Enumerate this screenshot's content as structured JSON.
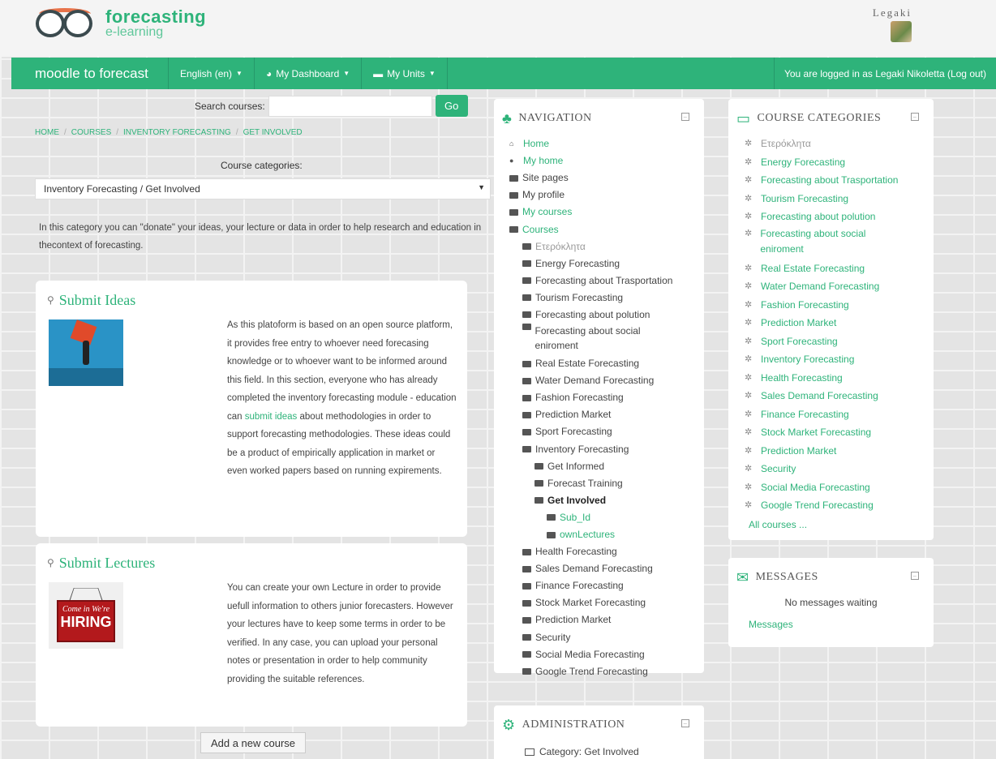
{
  "header": {
    "logo_main": "forecasting",
    "logo_sub": "e-learning",
    "user_name": "Legaki"
  },
  "navbar": {
    "brand": "moodle to forecast",
    "language": "English (en)",
    "dashboard": "My Dashboard",
    "units": "My Units",
    "login_text": "You are logged in as Legaki Nikoletta (Log out)"
  },
  "search": {
    "label": "Search courses:",
    "value": "",
    "button": "Go"
  },
  "breadcrumb": [
    "HOME",
    "COURSES",
    "INVENTORY FORECASTING",
    "GET INVOLVED"
  ],
  "category_select": {
    "label": "Course categories:",
    "value": "Inventory Forecasting / Get Involved"
  },
  "category_description": "In this category you can \"donate\" your ideas, your lecture or data in order to help research and education in thecontext of forecasting.",
  "cards": {
    "ideas": {
      "title": "Submit Ideas",
      "text_before": "As this platoform is based on an open source platform, it provides free entry to whoever need forecasing knowledge or to whoever want to be informed around this field. In this section, everyone who has already completed the inventory forecasting module - education can ",
      "link": "submit ideas",
      "text_after": " about methodologies in order to support forecasting methodologies. These ideas could be a product of empirically application in market or even worked papers based on running expirements."
    },
    "lectures": {
      "title": "Submit Lectures",
      "text": "You can create your own Lecture in order to provide uefull information to others junior forecasters. However your lectures have to keep some terms in order to be verified. In any case, you can upload your personal notes or presentation in order to help community providing the suitable references.",
      "image_text_a": "Come in We're",
      "image_text_b": "HIRING"
    }
  },
  "add_course": "Add a new course",
  "navigation": {
    "title": "NAVIGATION",
    "items": [
      {
        "label": "Home",
        "level": 0,
        "link": true,
        "icon": "home-icon"
      },
      {
        "label": "My home",
        "level": 0,
        "link": true,
        "icon": "dot-icon"
      },
      {
        "label": "Site pages",
        "level": 0,
        "link": false,
        "icon": "folder-icon"
      },
      {
        "label": "My profile",
        "level": 0,
        "link": false,
        "icon": "folder-icon"
      },
      {
        "label": "My courses",
        "level": 0,
        "link": true,
        "icon": "folder-icon"
      },
      {
        "label": "Courses",
        "level": 0,
        "link": true,
        "icon": "folder-icon"
      },
      {
        "label": "Ετερόκλητα",
        "level": 1,
        "link": false,
        "icon": "folder-icon",
        "muted": true
      },
      {
        "label": "Energy Forecasting",
        "level": 1,
        "link": false,
        "icon": "folder-icon"
      },
      {
        "label": "Forecasting about Trasportation",
        "level": 1,
        "link": false,
        "icon": "folder-icon"
      },
      {
        "label": "Tourism Forecasting",
        "level": 1,
        "link": false,
        "icon": "folder-icon"
      },
      {
        "label": "Forecasting about polution",
        "level": 1,
        "link": false,
        "icon": "folder-icon"
      },
      {
        "label": "Forecasting about social eniroment",
        "level": 1,
        "link": false,
        "icon": "folder-icon",
        "wrap": true
      },
      {
        "label": "Real Estate Forecasting",
        "level": 1,
        "link": false,
        "icon": "folder-icon"
      },
      {
        "label": "Water Demand Forecasting",
        "level": 1,
        "link": false,
        "icon": "folder-icon"
      },
      {
        "label": "Fashion Forecasting",
        "level": 1,
        "link": false,
        "icon": "folder-icon"
      },
      {
        "label": "Prediction Market",
        "level": 1,
        "link": false,
        "icon": "folder-icon"
      },
      {
        "label": "Sport Forecasting",
        "level": 1,
        "link": false,
        "icon": "folder-icon"
      },
      {
        "label": "Inventory Forecasting",
        "level": 1,
        "link": false,
        "icon": "folder-icon"
      },
      {
        "label": "Get Informed",
        "level": 2,
        "link": false,
        "icon": "folder-icon"
      },
      {
        "label": "Forecast Training",
        "level": 2,
        "link": false,
        "icon": "folder-icon"
      },
      {
        "label": "Get Involved",
        "level": 2,
        "link": false,
        "icon": "folder-icon",
        "active": true
      },
      {
        "label": "Sub_Id",
        "level": 3,
        "link": true,
        "icon": "folder-icon"
      },
      {
        "label": "ownLectures",
        "level": 3,
        "link": true,
        "icon": "folder-icon"
      },
      {
        "label": "Health Forecasting",
        "level": 1,
        "link": false,
        "icon": "folder-icon"
      },
      {
        "label": "Sales Demand Forecasting",
        "level": 1,
        "link": false,
        "icon": "folder-icon"
      },
      {
        "label": "Finance Forecasting",
        "level": 1,
        "link": false,
        "icon": "folder-icon"
      },
      {
        "label": "Stock Market Forecasting",
        "level": 1,
        "link": false,
        "icon": "folder-icon"
      },
      {
        "label": "Prediction Market",
        "level": 1,
        "link": false,
        "icon": "folder-icon"
      },
      {
        "label": "Security",
        "level": 1,
        "link": false,
        "icon": "folder-icon"
      },
      {
        "label": "Social Media Forecasting",
        "level": 1,
        "link": false,
        "icon": "folder-icon"
      },
      {
        "label": "Google Trend Forecasting",
        "level": 1,
        "link": false,
        "icon": "folder-icon"
      }
    ]
  },
  "administration": {
    "title": "ADMINISTRATION",
    "item": "Category: Get Involved"
  },
  "course_categories": {
    "title": "COURSE CATEGORIES",
    "items": [
      {
        "label": "Ετερόκλητα",
        "muted": true
      },
      {
        "label": "Energy Forecasting"
      },
      {
        "label": "Forecasting about Trasportation"
      },
      {
        "label": "Tourism Forecasting"
      },
      {
        "label": "Forecasting about polution"
      },
      {
        "label": "Forecasting about social eniroment",
        "wrap": true
      },
      {
        "label": "Real Estate Forecasting"
      },
      {
        "label": "Water Demand Forecasting"
      },
      {
        "label": "Fashion Forecasting"
      },
      {
        "label": "Prediction Market"
      },
      {
        "label": "Sport Forecasting"
      },
      {
        "label": "Inventory Forecasting"
      },
      {
        "label": "Health Forecasting"
      },
      {
        "label": "Sales Demand Forecasting"
      },
      {
        "label": "Finance Forecasting"
      },
      {
        "label": "Stock Market Forecasting"
      },
      {
        "label": "Prediction Market"
      },
      {
        "label": "Security"
      },
      {
        "label": "Social Media Forecasting"
      },
      {
        "label": "Google Trend Forecasting"
      }
    ],
    "all_courses": "All courses ..."
  },
  "messages": {
    "title": "MESSAGES",
    "none": "No messages waiting",
    "link": "Messages"
  },
  "colors": {
    "accent": "#2eb37a",
    "accent_dark": "#26986a",
    "logo_orange": "#e8734a"
  }
}
